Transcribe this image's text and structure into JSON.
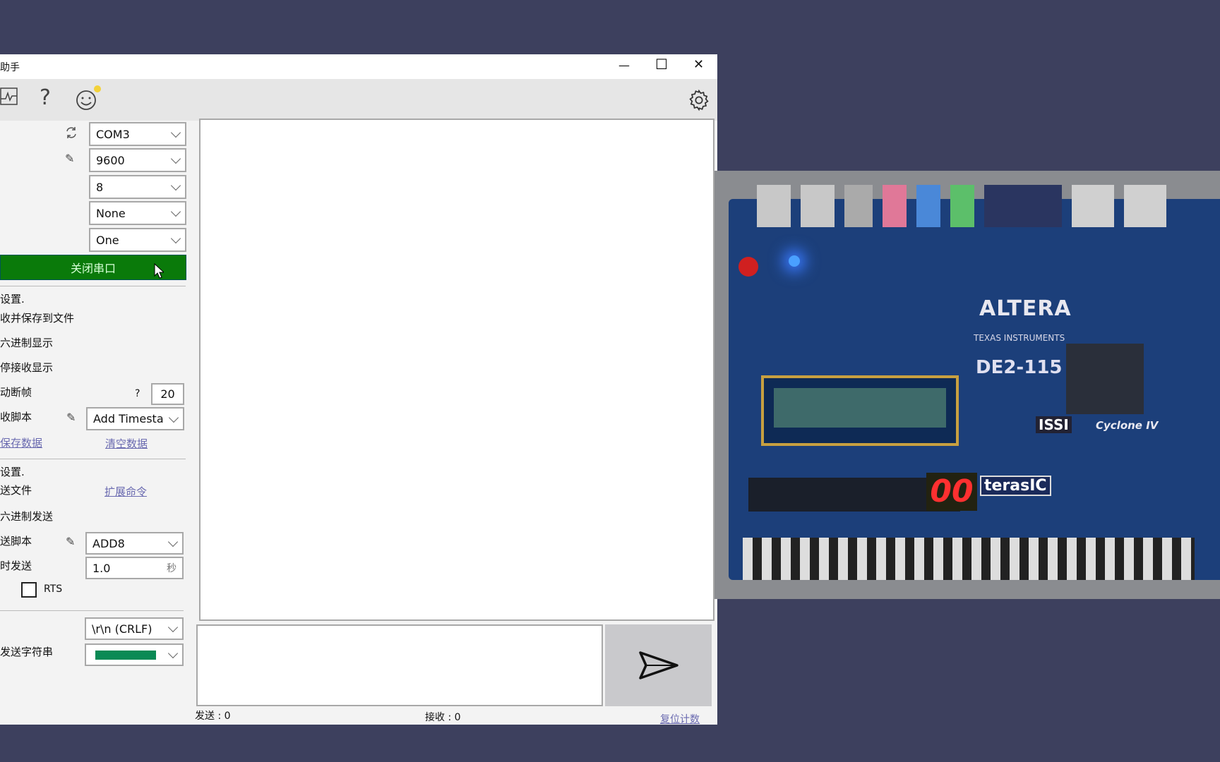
{
  "window": {
    "title": "助手",
    "minimize": "—",
    "maximize": "☐",
    "close": "✕"
  },
  "toolbar": {
    "icons": [
      "chart-icon",
      "help-icon",
      "smiley-icon",
      "settings-icon"
    ],
    "help_glyph": "?"
  },
  "serial": {
    "port": "COM3",
    "baud": "9600",
    "data_bits": "8",
    "parity": "None",
    "stop_bits": "One",
    "toggle_label": "关闭串口",
    "toggle_color": "#0a7a0a"
  },
  "receive": {
    "section": "设置.",
    "save_to_file": "收并保存到文件",
    "hex_display": "六进制显示",
    "pause_display": "停接收显示",
    "auto_frame": "动断帧",
    "frame_help": "?",
    "frame_value": "20",
    "script_label": "收脚本",
    "script_value": "Add Timesta",
    "save_data": "保存数据",
    "clear_data": "清空数据"
  },
  "send": {
    "section": "设置.",
    "send_file": "送文件",
    "ext_cmd": "扩展命令",
    "hex_send": "六进制发送",
    "script_label": "送脚本",
    "script_value": "ADD8",
    "timed_label": "时发送",
    "timed_value": "1.0",
    "timed_unit": "秒",
    "rts_label": "RTS",
    "rts_checked": false,
    "line_end": "\\r\\n (CRLF)",
    "string_label": "发送字符串",
    "string_color": "#0a8a55"
  },
  "status": {
    "sent": "发送 : 0",
    "received": "接收 : 0",
    "reset": "复位计数"
  },
  "photo": {
    "brand": "ALTERA",
    "model": "DE2-115",
    "maker": "terasIC",
    "chip": "Cyclone IV",
    "ti": "TEXAS INSTRUMENTS",
    "issi": "ISSI",
    "display": "00"
  }
}
